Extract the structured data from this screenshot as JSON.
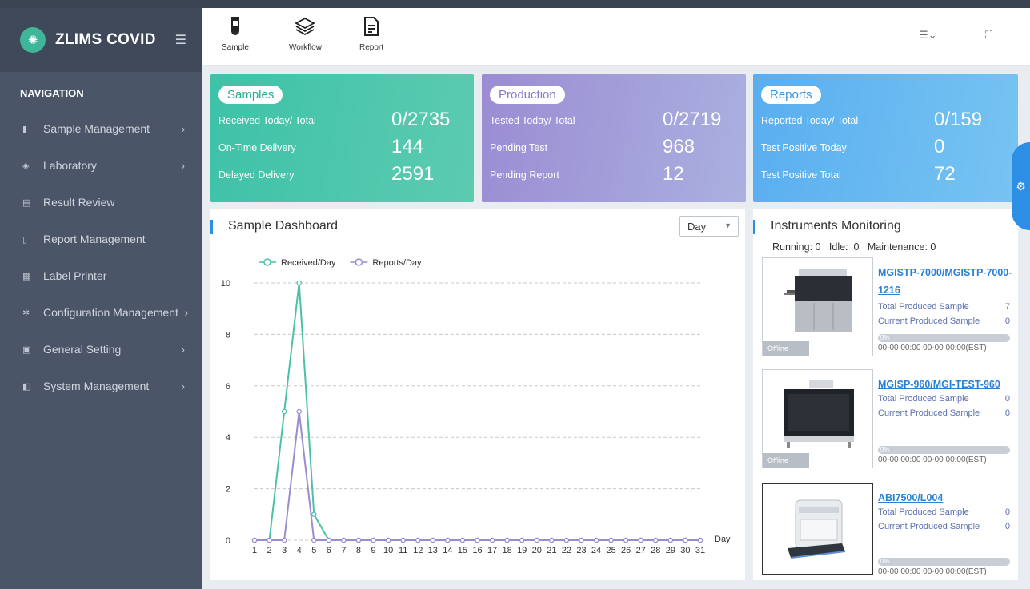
{
  "app": {
    "name": "ZLIMS COVID"
  },
  "nav": {
    "title": "NAVIGATION",
    "items": [
      {
        "label": "Sample Management",
        "has_children": true
      },
      {
        "label": "Laboratory",
        "has_children": true
      },
      {
        "label": "Result Review",
        "has_children": false
      },
      {
        "label": "Report Management",
        "has_children": false
      },
      {
        "label": "Label Printer",
        "has_children": false
      },
      {
        "label": "Configuration Management",
        "has_children": true
      },
      {
        "label": "General Setting",
        "has_children": true
      },
      {
        "label": "System Management",
        "has_children": true
      }
    ]
  },
  "toolbar": {
    "sample": "Sample",
    "workflow": "Workflow",
    "report": "Report"
  },
  "cards": {
    "samples": {
      "title": "Samples",
      "rows": [
        {
          "label": "Received Today/ Total",
          "value": "0/2735"
        },
        {
          "label": "On-Time Delivery",
          "value": "144"
        },
        {
          "label": "Delayed Delivery",
          "value": "2591"
        }
      ]
    },
    "production": {
      "title": "Production",
      "rows": [
        {
          "label": "Tested Today/ Total",
          "value": "0/2719"
        },
        {
          "label": "Pending Test",
          "value": "968"
        },
        {
          "label": "Pending Report",
          "value": "12"
        }
      ]
    },
    "reports": {
      "title": "Reports",
      "rows": [
        {
          "label": "Reported Today/ Total",
          "value": "0/159"
        },
        {
          "label": "Test Positive Today",
          "value": "0"
        },
        {
          "label": "Test Positive Total",
          "value": "72"
        }
      ]
    }
  },
  "dashboard": {
    "title": "Sample Dashboard",
    "period": "Day"
  },
  "chart_data": {
    "type": "line",
    "x": [
      1,
      2,
      3,
      4,
      5,
      6,
      7,
      8,
      9,
      10,
      11,
      12,
      13,
      14,
      15,
      16,
      17,
      18,
      19,
      20,
      21,
      22,
      23,
      24,
      25,
      26,
      27,
      28,
      29,
      30,
      31
    ],
    "xlabel": "Day",
    "ylim": [
      0,
      10
    ],
    "yticks": [
      0,
      2,
      4,
      6,
      8,
      10
    ],
    "grid": true,
    "legend": "top-left",
    "series": [
      {
        "name": "Received/Day",
        "color": "#4cc1a5",
        "values": [
          0,
          0,
          5,
          10,
          1,
          0,
          0,
          0,
          0,
          0,
          0,
          0,
          0,
          0,
          0,
          0,
          0,
          0,
          0,
          0,
          0,
          0,
          0,
          0,
          0,
          0,
          0,
          0,
          0,
          0,
          0
        ]
      },
      {
        "name": "Reports/Day",
        "color": "#9b8bd1",
        "values": [
          0,
          0,
          0,
          5,
          0,
          0,
          0,
          0,
          0,
          0,
          0,
          0,
          0,
          0,
          0,
          0,
          0,
          0,
          0,
          0,
          0,
          0,
          0,
          0,
          0,
          0,
          0,
          0,
          0,
          0,
          0
        ]
      }
    ]
  },
  "instruments": {
    "title": "Instruments Monitoring",
    "status": {
      "running_label": "Running:",
      "running": "0",
      "idle_label": "Idle:",
      "idle": "0",
      "maintenance_label": "Maintenance:",
      "maintenance": "0"
    },
    "total_label": "Total Produced Sample",
    "current_label": "Current Produced Sample",
    "list": [
      {
        "name": "MGISTP-7000/MGISTP-7000-1216",
        "total": "7",
        "current": "0",
        "progress": "0%",
        "progress_value": 0,
        "time": "00-00 00:00   00-00 00:00(EST)",
        "state": "Offline"
      },
      {
        "name": "MGISP-960/MGI-TEST-960",
        "total": "0",
        "current": "0",
        "progress": "0%",
        "progress_value": 0,
        "time": "00-00 00:00   00-00 00:00(EST)",
        "state": "Offline"
      },
      {
        "name": "ABI7500/L004",
        "total": "0",
        "current": "0",
        "progress": "0%",
        "progress_value": 0,
        "time": "00-00 00:00   00-00 00:00(EST)",
        "state": ""
      }
    ]
  }
}
